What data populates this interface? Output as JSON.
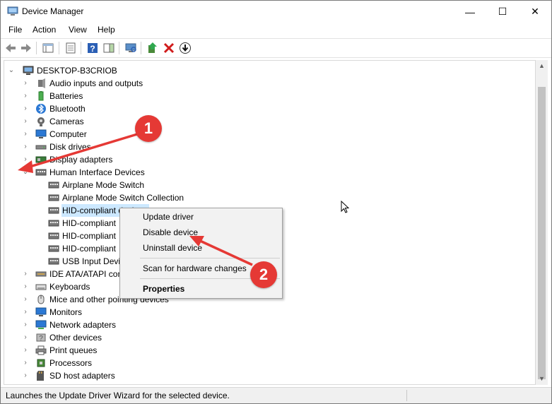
{
  "window": {
    "title": "Device Manager",
    "controls": {
      "minimize": "—",
      "maximize": "☐",
      "close": "✕"
    }
  },
  "menu": [
    "File",
    "Action",
    "View",
    "Help"
  ],
  "tree": {
    "root": "DESKTOP-B3CRIOB",
    "categories": [
      "Audio inputs and outputs",
      "Batteries",
      "Bluetooth",
      "Cameras",
      "Computer",
      "Disk drives",
      "Display adapters",
      "Human Interface Devices"
    ],
    "hid_children": [
      "Airplane Mode Switch",
      "Airplane Mode Switch Collection",
      "HID-compliant device",
      "HID-compliant",
      "HID-compliant",
      "HID-compliant",
      "USB Input Devi"
    ],
    "categories_after": [
      "IDE ATA/ATAPI con",
      "Keyboards",
      "Mice and other pointing devices",
      "Monitors",
      "Network adapters",
      "Other devices",
      "Print queues",
      "Processors",
      "SD host adapters"
    ]
  },
  "context_menu": {
    "items": [
      "Update driver",
      "Disable device",
      "Uninstall device"
    ],
    "scan": "Scan for hardware changes",
    "properties": "Properties"
  },
  "status": "Launches the Update Driver Wizard for the selected device.",
  "annotations": {
    "badge1": "1",
    "badge2": "2",
    "color": "#e53935"
  }
}
